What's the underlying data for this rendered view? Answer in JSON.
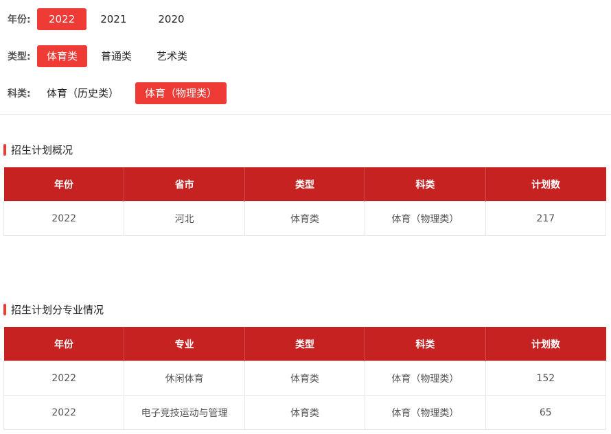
{
  "filters": {
    "year": {
      "label": "年份:",
      "options": [
        "2022",
        "2021",
        "2020"
      ],
      "active": 0
    },
    "type": {
      "label": "类型:",
      "options": [
        "体育类",
        "普通类",
        "艺术类"
      ],
      "active": 0
    },
    "subject": {
      "label": "科类:",
      "options": [
        "体育（历史类）",
        "体育（物理类）"
      ],
      "active": 1
    }
  },
  "overview": {
    "title": "招生计划概况",
    "headers": [
      "年份",
      "省市",
      "类型",
      "科类",
      "计划数"
    ],
    "rows": [
      [
        "2022",
        "河北",
        "体育类",
        "体育（物理类）",
        "217"
      ]
    ]
  },
  "by_major": {
    "title": "招生计划分专业情况",
    "headers": [
      "年份",
      "专业",
      "类型",
      "科类",
      "计划数"
    ],
    "rows": [
      [
        "2022",
        "休闲体育",
        "体育类",
        "体育（物理类）",
        "152"
      ],
      [
        "2022",
        "电子竞技运动与管理",
        "体育类",
        "体育（物理类）",
        "65"
      ]
    ]
  },
  "colors": {
    "accent": "#ef3b36",
    "header_bg": "#c72222"
  }
}
